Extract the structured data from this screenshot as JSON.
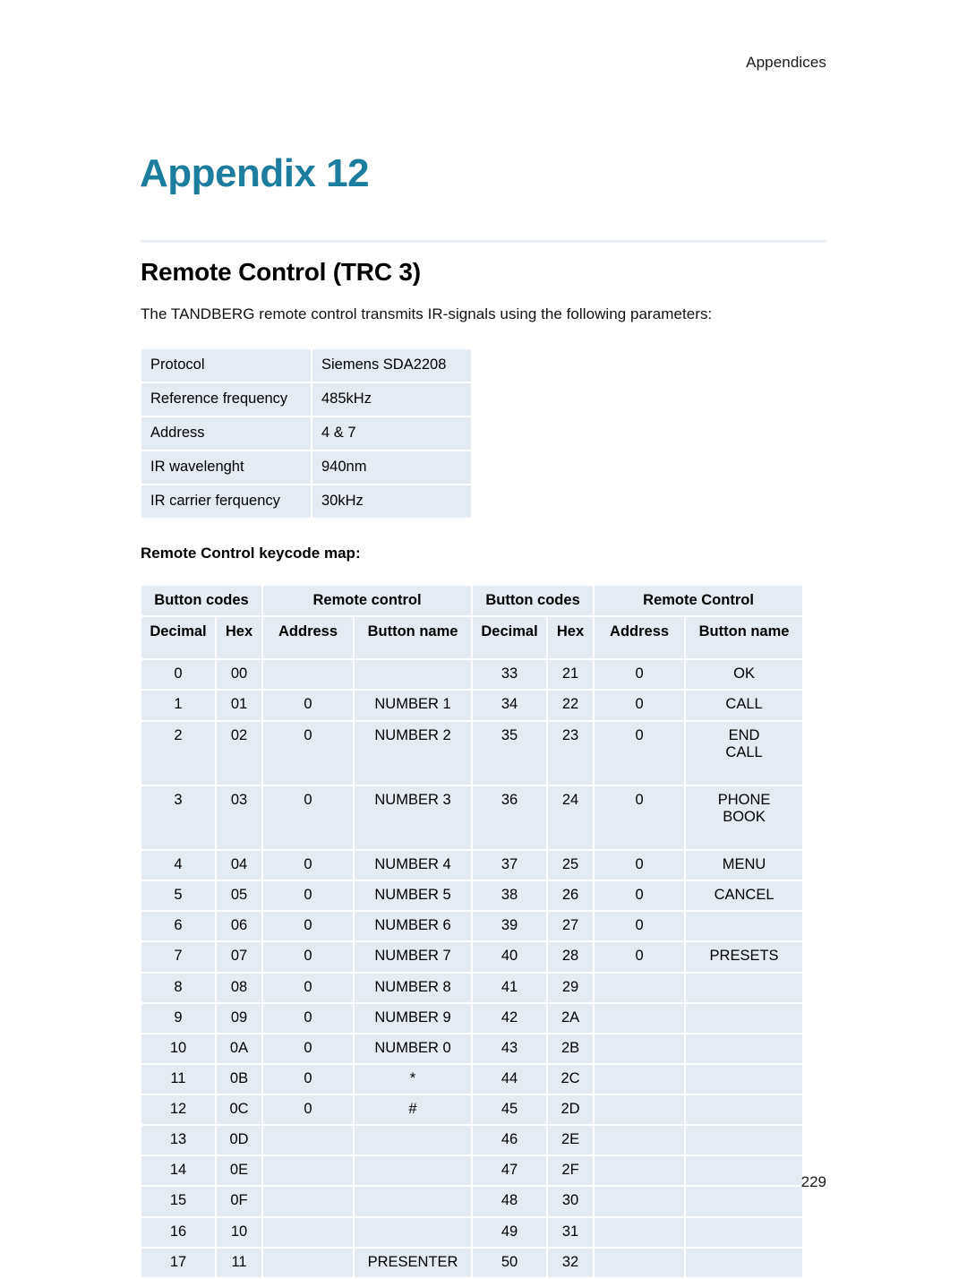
{
  "header": {
    "running_head": "Appendices"
  },
  "appendix": {
    "title": "Appendix 12"
  },
  "section": {
    "heading": "Remote Control (TRC 3)",
    "intro": "The TANDBERG remote control transmits IR-signals using the following parameters:"
  },
  "params_table": {
    "rows": [
      {
        "key": "Protocol",
        "value": "Siemens SDA2208"
      },
      {
        "key": "Reference frequency",
        "value": "485kHz"
      },
      {
        "key": "Address",
        "value": "4 & 7"
      },
      {
        "key": "IR wavelenght",
        "value": "940nm"
      },
      {
        "key": "IR carrier ferquency",
        "value": "30kHz"
      }
    ]
  },
  "keycode_map": {
    "label": "Remote Control keycode map:",
    "group_headers": [
      "Button codes",
      "Remote control",
      "Button codes",
      "Remote Control"
    ],
    "column_headers": [
      "Decimal",
      "Hex",
      "Address",
      "Button name",
      "Decimal",
      "Hex",
      "Address",
      "Button name"
    ],
    "rows": [
      {
        "tall": false,
        "cells": [
          "0",
          "00",
          "",
          "",
          "33",
          "21",
          "0",
          "OK"
        ]
      },
      {
        "tall": false,
        "cells": [
          "1",
          "01",
          "0",
          "NUMBER 1",
          "34",
          "22",
          "0",
          "CALL"
        ]
      },
      {
        "tall": true,
        "cells": [
          "2",
          "02",
          "0",
          "NUMBER 2",
          "35",
          "23",
          "0",
          "END CALL"
        ]
      },
      {
        "tall": true,
        "cells": [
          "3",
          "03",
          "0",
          "NUMBER 3",
          "36",
          "24",
          "0",
          "PHONE BOOK"
        ]
      },
      {
        "tall": false,
        "cells": [
          "4",
          "04",
          "0",
          "NUMBER 4",
          "37",
          "25",
          "0",
          "MENU"
        ]
      },
      {
        "tall": false,
        "cells": [
          "5",
          "05",
          "0",
          "NUMBER 5",
          "38",
          "26",
          "0",
          "CANCEL"
        ]
      },
      {
        "tall": false,
        "cells": [
          "6",
          "06",
          "0",
          "NUMBER 6",
          "39",
          "27",
          "0",
          ""
        ]
      },
      {
        "tall": false,
        "cells": [
          "7",
          "07",
          "0",
          "NUMBER 7",
          "40",
          "28",
          "0",
          "PRESETS"
        ]
      },
      {
        "tall": false,
        "cells": [
          "8",
          "08",
          "0",
          "NUMBER 8",
          "41",
          "29",
          "",
          ""
        ]
      },
      {
        "tall": false,
        "cells": [
          "9",
          "09",
          "0",
          "NUMBER 9",
          "42",
          "2A",
          "",
          ""
        ]
      },
      {
        "tall": false,
        "cells": [
          "10",
          "0A",
          "0",
          "NUMBER 0",
          "43",
          "2B",
          "",
          ""
        ]
      },
      {
        "tall": false,
        "cells": [
          "11",
          "0B",
          "0",
          "*",
          "44",
          "2C",
          "",
          ""
        ]
      },
      {
        "tall": false,
        "cells": [
          "12",
          "0C",
          "0",
          "#",
          "45",
          "2D",
          "",
          ""
        ]
      },
      {
        "tall": false,
        "cells": [
          "13",
          "0D",
          "",
          "",
          "46",
          "2E",
          "",
          ""
        ]
      },
      {
        "tall": false,
        "cells": [
          "14",
          "0E",
          "",
          "",
          "47",
          "2F",
          "",
          ""
        ]
      },
      {
        "tall": false,
        "cells": [
          "15",
          "0F",
          "",
          "",
          "48",
          "30",
          "",
          ""
        ]
      },
      {
        "tall": false,
        "cells": [
          "16",
          "10",
          "",
          "",
          "49",
          "31",
          "",
          ""
        ]
      },
      {
        "tall": false,
        "cells": [
          "17",
          "11",
          "",
          "PRESENTER",
          "50",
          "32",
          "",
          ""
        ]
      }
    ]
  },
  "footer": {
    "page_number": "229"
  },
  "colors": {
    "accent": "#1d7d9e",
    "cell_fill": "#e4ebf2",
    "rule": "#e9eef7"
  }
}
